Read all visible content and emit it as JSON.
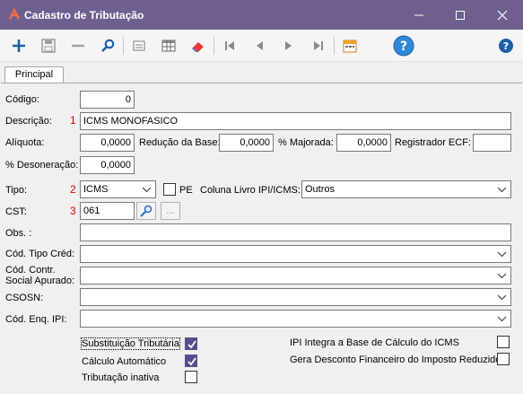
{
  "window": {
    "title": "Cadastro de Tributação",
    "brand_color": "#6f5f8f"
  },
  "tabs": [
    {
      "label": "Principal",
      "selected": true
    }
  ],
  "form": {
    "codigo": {
      "label": "Código:",
      "value": "0"
    },
    "descricao": {
      "label": "Descrição:",
      "marker": "1",
      "value": "ICMS MONOFASICO"
    },
    "aliquota": {
      "label": "Alíquota:",
      "value": "0,0000"
    },
    "reducao_base": {
      "label": "Redução da Base:",
      "value": "0,0000"
    },
    "majorada": {
      "label": "% Majorada:",
      "value": "0,0000"
    },
    "registrador_ecf": {
      "label": "Registrador ECF:",
      "value": ""
    },
    "desoneracao": {
      "label": "% Desoneração:",
      "value": "0,0000"
    },
    "tipo": {
      "label": "Tipo:",
      "marker": "2",
      "value": "ICMS"
    },
    "pe": {
      "label": "PE",
      "checked": false
    },
    "coluna_livro": {
      "label": "Coluna Livro IPI/ICMS:",
      "value": "Outros"
    },
    "cst": {
      "label": "CST:",
      "marker": "3",
      "value": "061",
      "ellipsis_label": "..."
    },
    "obs": {
      "label": "Obs. :",
      "value": ""
    },
    "cod_tipo_cred": {
      "label": "Cód. Tipo Créd:",
      "value": ""
    },
    "cod_contr_social": {
      "label_line1": "Cód. Contr.",
      "label_line2": "Social Apurado:",
      "value": ""
    },
    "csosn": {
      "label": "CSOSN:",
      "value": ""
    },
    "cod_enq_ipi": {
      "label": "Cód. Enq. IPI:",
      "value": ""
    }
  },
  "checkboxes_left": [
    {
      "label": "Substituição Tributária",
      "checked": true
    },
    {
      "label": "Cálculo Automático",
      "checked": true
    },
    {
      "label": "Tributação inativa",
      "checked": false
    }
  ],
  "checkboxes_right": [
    {
      "label": "IPI Integra a Base de Cálculo do ICMS",
      "checked": false
    },
    {
      "label": "Gera Desconto Financeiro do Imposto Reduzido",
      "checked": false
    }
  ]
}
